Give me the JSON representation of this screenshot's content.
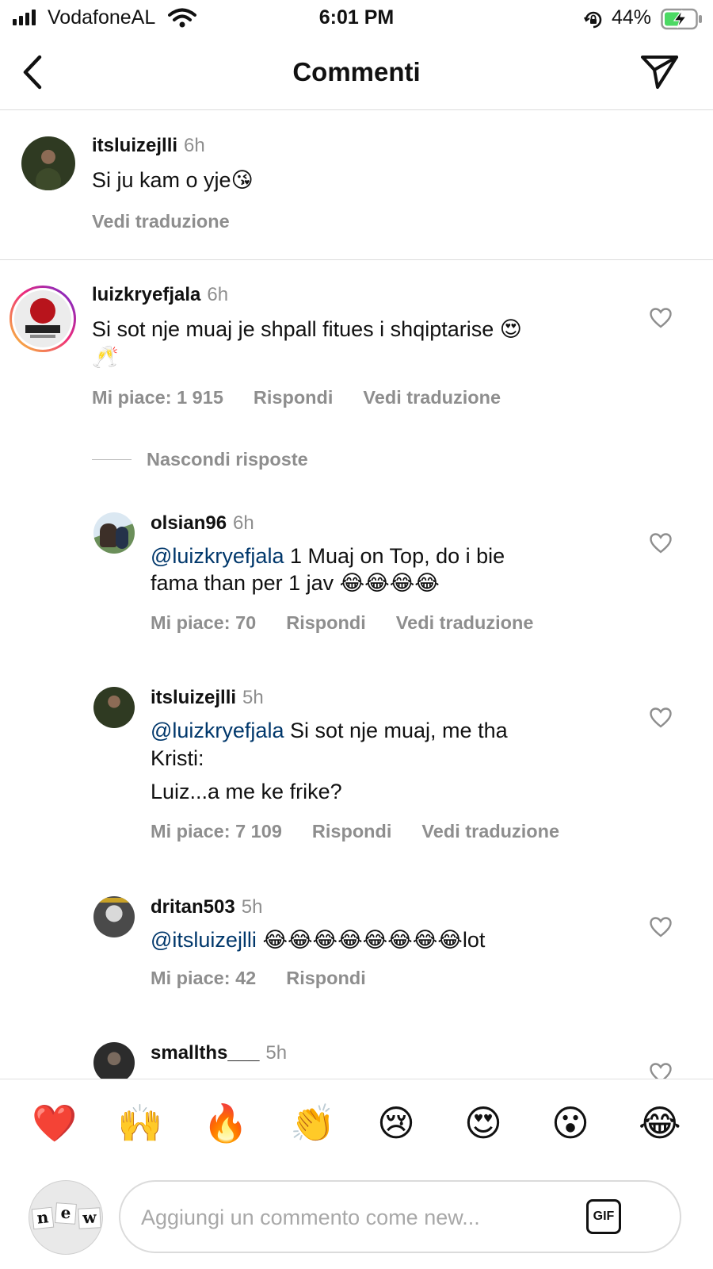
{
  "status_bar": {
    "carrier": "VodafoneAL",
    "time": "6:01 PM",
    "battery": "44%"
  },
  "header": {
    "title": "Commenti",
    "back_icon": "chevron-left-icon",
    "share_icon": "paper-plane-icon"
  },
  "caption": {
    "username": "itsluizejlli",
    "time": "6h",
    "text": "Si ju kam o yje😘",
    "see_translation": "Vedi traduzione"
  },
  "comment": {
    "username": "luizkryefjala",
    "time": "6h",
    "text_line1": "Si sot nje muaj je shpall fitues i shqiptarise 😍",
    "text_line2": "🥂",
    "likes": "Mi piace: 1 915",
    "reply": "Rispondi",
    "see_translation": "Vedi traduzione",
    "hide_replies": "Nascondi risposte"
  },
  "replies": [
    {
      "username": "olsian96",
      "time": "6h",
      "mention": "@luizkryefjala",
      "text_line1": " 1 Muaj on Top, do i bie",
      "text_line2": "fama than per 1 jav 😂😂😂😂",
      "likes": "Mi piace: 70",
      "reply": "Rispondi",
      "see_translation": "Vedi traduzione"
    },
    {
      "username": "itsluizejlli",
      "time": "5h",
      "mention": "@luizkryefjala",
      "text_line1": " Si sot nje muaj, me tha",
      "text_line2": "Kristi:",
      "text_line3": "Luiz...a me ke frike?",
      "likes": "Mi piace: 7 109",
      "reply": "Rispondi",
      "see_translation": "Vedi traduzione"
    },
    {
      "username": "dritan503",
      "time": "5h",
      "mention": "@itsluizejlli",
      "text_line1": " 😂😂😂😂😂😂😂😂lot",
      "likes": "Mi piace: 42",
      "reply": "Rispondi"
    },
    {
      "username": "smallths___",
      "time": "5h"
    }
  ],
  "emoji_bar": [
    "❤️",
    "🙌",
    "🔥",
    "👏",
    "😢",
    "😍",
    "😮",
    "😂"
  ],
  "composer": {
    "placeholder": "Aggiungi un commento come new...",
    "gif_label": "GIF",
    "avatar_letters": [
      "n",
      "e",
      "w"
    ]
  }
}
